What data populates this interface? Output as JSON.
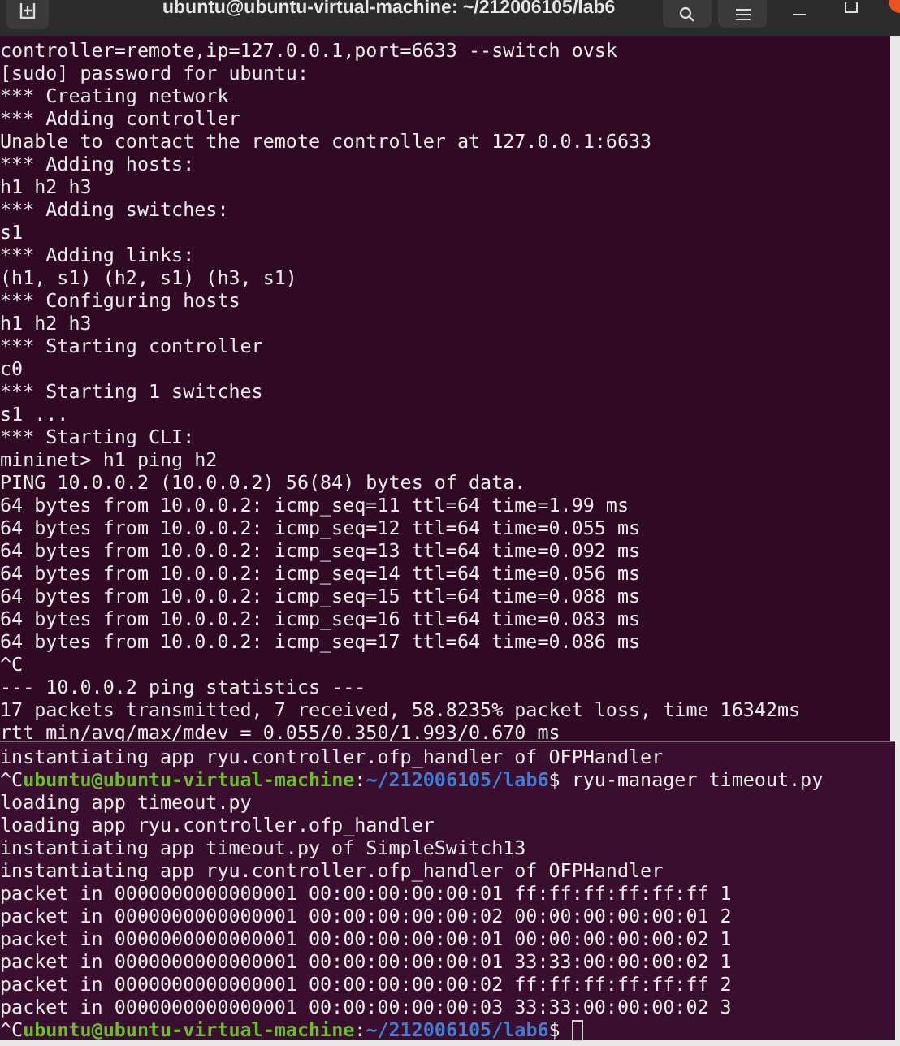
{
  "top_window": {
    "title": "ubuntu@ubuntu-virtual-machine: ~/212006105/lab6",
    "lines": [
      {
        "kind": "output",
        "text": "controller=remote,ip=127.0.0.1,port=6633 --switch ovsk"
      },
      {
        "kind": "output",
        "text": "[sudo] password for ubuntu:"
      },
      {
        "kind": "output",
        "text": "*** Creating network"
      },
      {
        "kind": "output",
        "text": "*** Adding controller"
      },
      {
        "kind": "output",
        "text": "Unable to contact the remote controller at 127.0.0.1:6633"
      },
      {
        "kind": "output",
        "text": "*** Adding hosts:"
      },
      {
        "kind": "output",
        "text": "h1 h2 h3"
      },
      {
        "kind": "output",
        "text": "*** Adding switches:"
      },
      {
        "kind": "output",
        "text": "s1"
      },
      {
        "kind": "output",
        "text": "*** Adding links:"
      },
      {
        "kind": "output",
        "text": "(h1, s1) (h2, s1) (h3, s1)"
      },
      {
        "kind": "output",
        "text": "*** Configuring hosts"
      },
      {
        "kind": "output",
        "text": "h1 h2 h3"
      },
      {
        "kind": "output",
        "text": "*** Starting controller"
      },
      {
        "kind": "output",
        "text": "c0"
      },
      {
        "kind": "output",
        "text": "*** Starting 1 switches"
      },
      {
        "kind": "output",
        "text": "s1 ..."
      },
      {
        "kind": "output",
        "text": "*** Starting CLI:"
      },
      {
        "kind": "output",
        "text": "mininet> h1 ping h2"
      },
      {
        "kind": "output",
        "text": "PING 10.0.0.2 (10.0.0.2) 56(84) bytes of data."
      },
      {
        "kind": "output",
        "text": "64 bytes from 10.0.0.2: icmp_seq=11 ttl=64 time=1.99 ms"
      },
      {
        "kind": "output",
        "text": "64 bytes from 10.0.0.2: icmp_seq=12 ttl=64 time=0.055 ms"
      },
      {
        "kind": "output",
        "text": "64 bytes from 10.0.0.2: icmp_seq=13 ttl=64 time=0.092 ms"
      },
      {
        "kind": "output",
        "text": "64 bytes from 10.0.0.2: icmp_seq=14 ttl=64 time=0.056 ms"
      },
      {
        "kind": "output",
        "text": "64 bytes from 10.0.0.2: icmp_seq=15 ttl=64 time=0.088 ms"
      },
      {
        "kind": "output",
        "text": "64 bytes from 10.0.0.2: icmp_seq=16 ttl=64 time=0.083 ms"
      },
      {
        "kind": "output",
        "text": "64 bytes from 10.0.0.2: icmp_seq=17 ttl=64 time=0.086 ms"
      },
      {
        "kind": "output",
        "text": "^C"
      },
      {
        "kind": "output",
        "text": "--- 10.0.0.2 ping statistics ---"
      },
      {
        "kind": "output",
        "text": "17 packets transmitted, 7 received, 58.8235% packet loss, time 16342ms"
      },
      {
        "kind": "output",
        "text": "rtt min/avg/max/mdev = 0.055/0.350/1.993/0.670 ms"
      }
    ]
  },
  "bottom_window": {
    "lines": [
      {
        "kind": "output",
        "text": "instantiating app ryu.controller.ofp_handler of OFPHandler"
      },
      {
        "kind": "prompt",
        "prefix": "^C",
        "user": "ubuntu@ubuntu-virtual-machine",
        "separator": ":",
        "path": "~/212006105/lab6",
        "symbol": "$",
        "command": "ryu-manager timeout.py",
        "cursor": false
      },
      {
        "kind": "output",
        "text": "loading app timeout.py"
      },
      {
        "kind": "output",
        "text": "loading app ryu.controller.ofp_handler"
      },
      {
        "kind": "output",
        "text": "instantiating app timeout.py of SimpleSwitch13"
      },
      {
        "kind": "output",
        "text": "instantiating app ryu.controller.ofp_handler of OFPHandler"
      },
      {
        "kind": "output",
        "text": "packet in 0000000000000001 00:00:00:00:00:01 ff:ff:ff:ff:ff:ff 1"
      },
      {
        "kind": "output",
        "text": "packet in 0000000000000001 00:00:00:00:00:02 00:00:00:00:00:01 2"
      },
      {
        "kind": "output",
        "text": "packet in 0000000000000001 00:00:00:00:00:01 00:00:00:00:00:02 1"
      },
      {
        "kind": "output",
        "text": "packet in 0000000000000001 00:00:00:00:00:01 33:33:00:00:00:02 1"
      },
      {
        "kind": "output",
        "text": "packet in 0000000000000001 00:00:00:00:00:02 ff:ff:ff:ff:ff:ff 2"
      },
      {
        "kind": "output",
        "text": "packet in 0000000000000001 00:00:00:00:00:03 33:33:00:00:00:02 3"
      },
      {
        "kind": "prompt",
        "prefix": "^C",
        "user": "ubuntu@ubuntu-virtual-machine",
        "separator": ":",
        "path": "~/212006105/lab6",
        "symbol": "$",
        "cursor": true
      }
    ]
  }
}
